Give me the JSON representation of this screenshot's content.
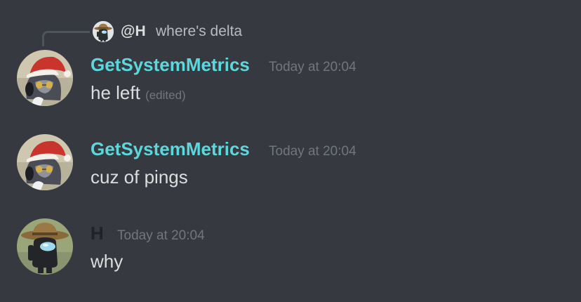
{
  "reply": {
    "author": "@H",
    "text": "where's delta"
  },
  "messages": [
    {
      "author": "GetSystemMetrics",
      "author_color": "#5cd8dc",
      "timestamp": "Today at 20:04",
      "text": "he left",
      "edited": "(edited)",
      "avatar_icon": "santa-hat-cat-avatar-icon"
    },
    {
      "author": "GetSystemMetrics",
      "author_color": "#5cd8dc",
      "timestamp": "Today at 20:04",
      "text": "cuz of pings",
      "avatar_icon": "santa-hat-cat-avatar-icon"
    },
    {
      "author": "H",
      "author_color": "#202225",
      "timestamp": "Today at 20:04",
      "text": "why",
      "avatar_icon": "cowboy-crewmate-avatar-icon"
    }
  ],
  "colors": {
    "background": "#36393f",
    "message_text": "#dcddde",
    "timestamp": "#72767d"
  }
}
